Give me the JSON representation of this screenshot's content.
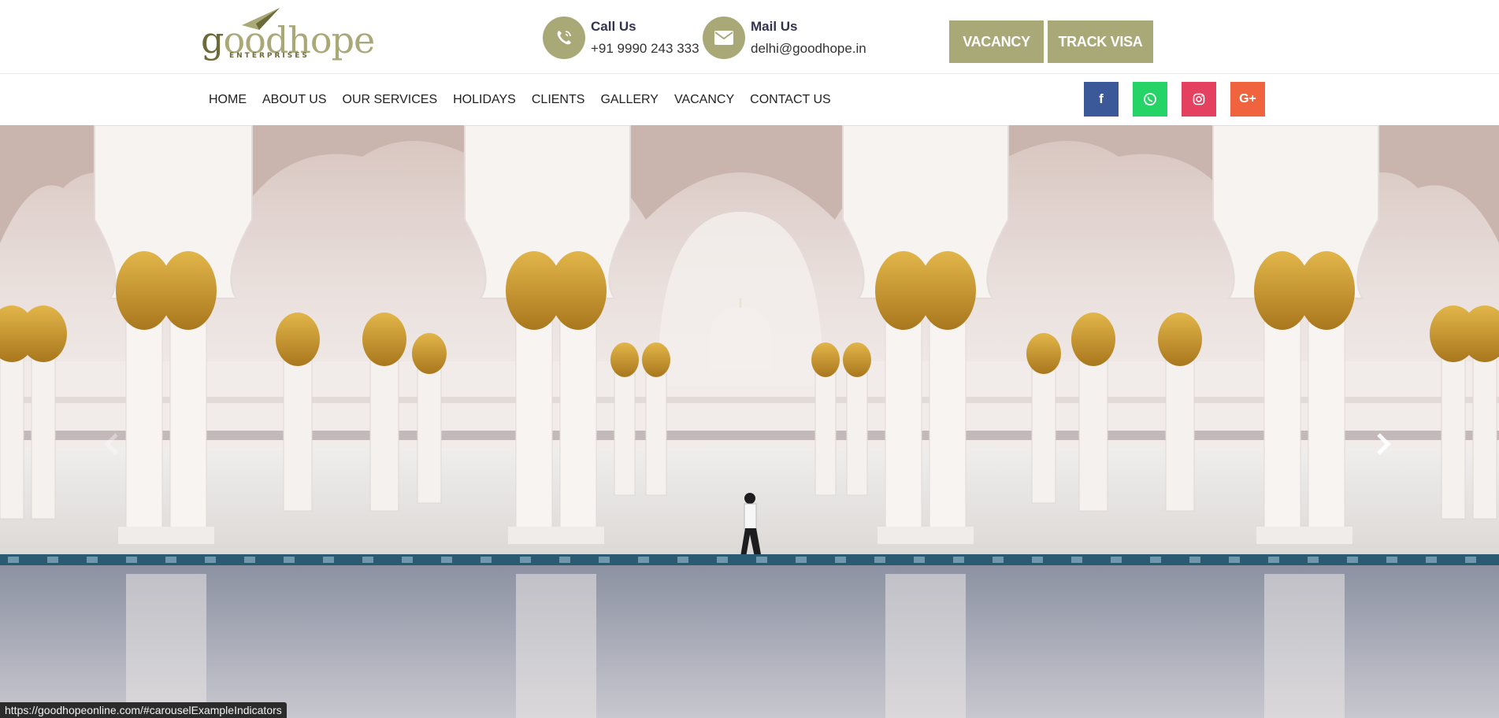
{
  "logo": {
    "brand": "oodhope",
    "brand_initial": "g",
    "subtitle": "ENTERPRISES"
  },
  "contact": {
    "call": {
      "title": "Call Us",
      "value": "+91 9990 243 333",
      "icon": "phone-icon"
    },
    "mail": {
      "title": "Mail Us",
      "value": "delhi@goodhope.in",
      "icon": "envelope-icon"
    }
  },
  "header_buttons": {
    "vacancy": "VACANCY",
    "track_visa": "TRACK VISA"
  },
  "nav": {
    "items": [
      "HOME",
      "ABOUT US",
      "OUR SERVICES",
      "HOLIDAYS",
      "CLIENTS",
      "GALLERY",
      "VACANCY",
      "CONTACT US"
    ]
  },
  "social": {
    "facebook": "f",
    "google_plus": "G+",
    "icons": [
      "facebook-icon",
      "whatsapp-icon",
      "instagram-icon",
      "google-plus-icon"
    ]
  },
  "carousel": {
    "prev_icon": "chevron-left-icon",
    "next_icon": "chevron-right-icon"
  },
  "status_bar": {
    "url": "https://goodhopeonline.com/#carouselExampleIndicators"
  },
  "colors": {
    "accent": "#a9a978",
    "facebook": "#3b5998",
    "whatsapp": "#25d366",
    "instagram": "#e4405f",
    "google_plus": "#f0633f"
  }
}
